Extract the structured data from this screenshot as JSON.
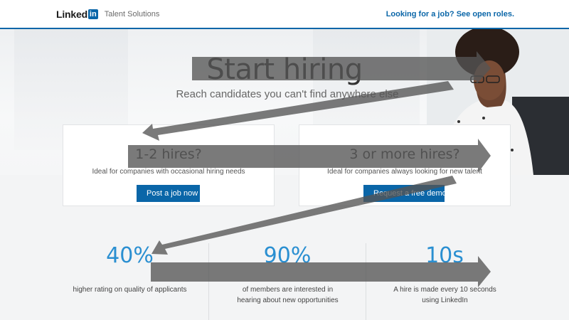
{
  "header": {
    "logo_word": "Linked",
    "logo_in": "in",
    "product": "Talent Solutions",
    "link": "Looking for a job? See open roles."
  },
  "hero": {
    "title": "Start hiring",
    "subtitle": "Reach candidates you can't find anywhere else"
  },
  "plans": [
    {
      "title": "1-2 hires?",
      "description": "Ideal for companies with occasional hiring needs",
      "button": "Post a job now"
    },
    {
      "title": "3 or more hires?",
      "description": "Ideal for companies always looking for new talent",
      "button": "Request a free demo"
    }
  ],
  "stats": [
    {
      "value": "40%",
      "description": "higher rating on quality of applicants"
    },
    {
      "value": "90%",
      "description": "of members are interested in hearing about new opportunities"
    },
    {
      "value": "10s",
      "description": "A hire is made every 10 seconds using LinkedIn"
    }
  ],
  "colors": {
    "brand": "#0a66a8",
    "stat_accent": "#2a8fd1",
    "overlay_arrow": "#555555"
  }
}
